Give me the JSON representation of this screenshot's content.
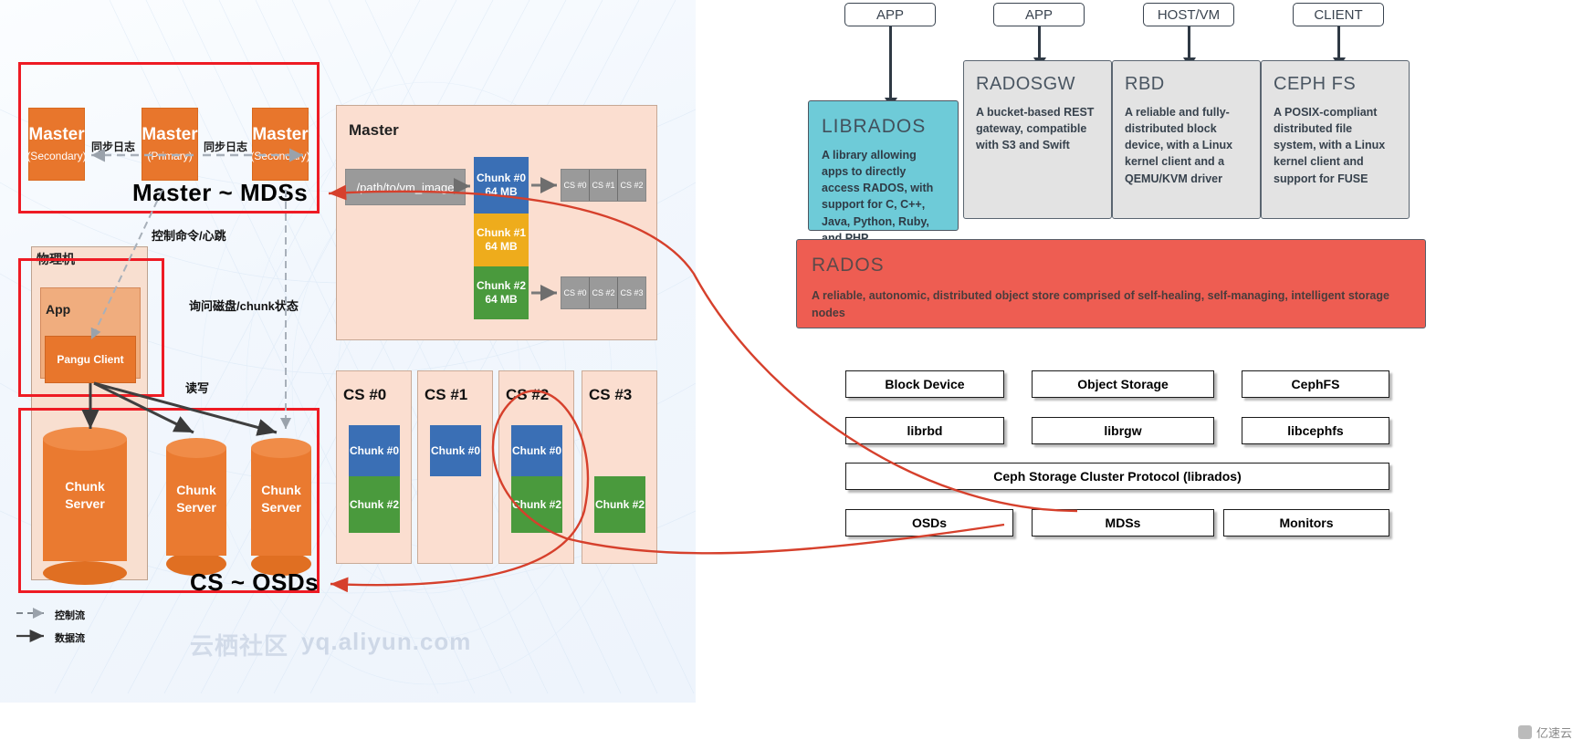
{
  "left": {
    "title_master_group": "Master ~ MDSs",
    "title_cs_group": "CS ~ OSDs",
    "masters": [
      {
        "name": "Master",
        "role": "(Secondary)"
      },
      {
        "name": "Master",
        "role": "(Primary)"
      },
      {
        "name": "Master",
        "role": "(Secondary)"
      }
    ],
    "sync_labels": [
      "同步日志",
      "同步日志"
    ],
    "flow_labels": {
      "control": "控制命令/心跳",
      "query": "询问磁盘/chunk状态",
      "rw": "读写"
    },
    "host": {
      "label": "物理机",
      "app_label": "App",
      "client_label": "Pangu Client"
    },
    "chunk_servers": [
      {
        "line1": "Chunk",
        "line2": "Server"
      },
      {
        "line1": "Chunk",
        "line2": "Server"
      },
      {
        "line1": "Chunk",
        "line2": "Server"
      }
    ],
    "legend": [
      {
        "style": "dashed",
        "label": "控制流"
      },
      {
        "style": "solid",
        "label": "数据流"
      }
    ],
    "master_panel": {
      "title": "Master",
      "path_label": "/path/to/vm_image",
      "chunks": [
        {
          "name": "Chunk #0",
          "size": "64 MB",
          "color": "#3a6fb5"
        },
        {
          "name": "Chunk #1",
          "size": "64 MB",
          "color": "#eeac1c"
        },
        {
          "name": "Chunk #2",
          "size": "64 MB",
          "color": "#4a9a3d"
        }
      ],
      "replica_rows": [
        {
          "for_chunk": "Chunk #0",
          "servers": [
            "CS #0",
            "CS #1",
            "CS #2"
          ]
        },
        {
          "for_chunk": "Chunk #2",
          "servers": [
            "CS #0",
            "CS #2",
            "CS #3"
          ]
        }
      ]
    },
    "cs_columns": [
      {
        "title": "CS #0",
        "chunks": [
          {
            "label": "Chunk #0",
            "color": "#3a6fb5"
          },
          {
            "label": "Chunk #2",
            "color": "#4a9a3d"
          }
        ]
      },
      {
        "title": "CS #1",
        "chunks": [
          {
            "label": "Chunk #0",
            "color": "#3a6fb5"
          }
        ]
      },
      {
        "title": "CS #2",
        "chunks": [
          {
            "label": "Chunk #0",
            "color": "#3a6fb5"
          },
          {
            "label": "Chunk #2",
            "color": "#4a9a3d"
          }
        ]
      },
      {
        "title": "CS #3",
        "chunks": [
          {
            "label": "Chunk #2",
            "color": "#4a9a3d"
          }
        ]
      }
    ],
    "watermark": "云栖社区",
    "watermark_url": "yq.aliyun.com"
  },
  "right": {
    "clients": [
      "APP",
      "APP",
      "HOST/VM",
      "CLIENT"
    ],
    "librados": {
      "title": "LIBRADOS",
      "body": "A library allowing apps to directly access RADOS, with support for C, C++, Java, Python, Ruby, and PHP"
    },
    "cards": [
      {
        "title": "RADOSGW",
        "body": "A bucket-based REST gateway, compatible with S3 and Swift"
      },
      {
        "title": "RBD",
        "body": "A reliable and fully-distributed block device, with a Linux kernel client and a QEMU/KVM driver"
      },
      {
        "title": "CEPH FS",
        "body": "A POSIX-compliant distributed file system, with a Linux kernel client and support for FUSE"
      }
    ],
    "rados": {
      "title": "RADOS",
      "body": "A reliable, autonomic, distributed object store comprised of self-healing, self-managing, intelligent storage nodes"
    },
    "stack": {
      "row1": [
        "Block Device",
        "Object Storage",
        "CephFS"
      ],
      "row2": [
        "librbd",
        "librgw",
        "libcephfs"
      ],
      "protocol": "Ceph Storage Cluster Protocol (librados)",
      "row3": [
        "OSDs",
        "MDSs",
        "Monitors"
      ]
    },
    "brand": "亿速云"
  },
  "colors": {
    "accent_red": "#ee1b24",
    "orange": "#e8762c",
    "cyan": "#6ecbd8",
    "rados_red": "#ee5d52",
    "arrow_red": "#d6402c"
  }
}
